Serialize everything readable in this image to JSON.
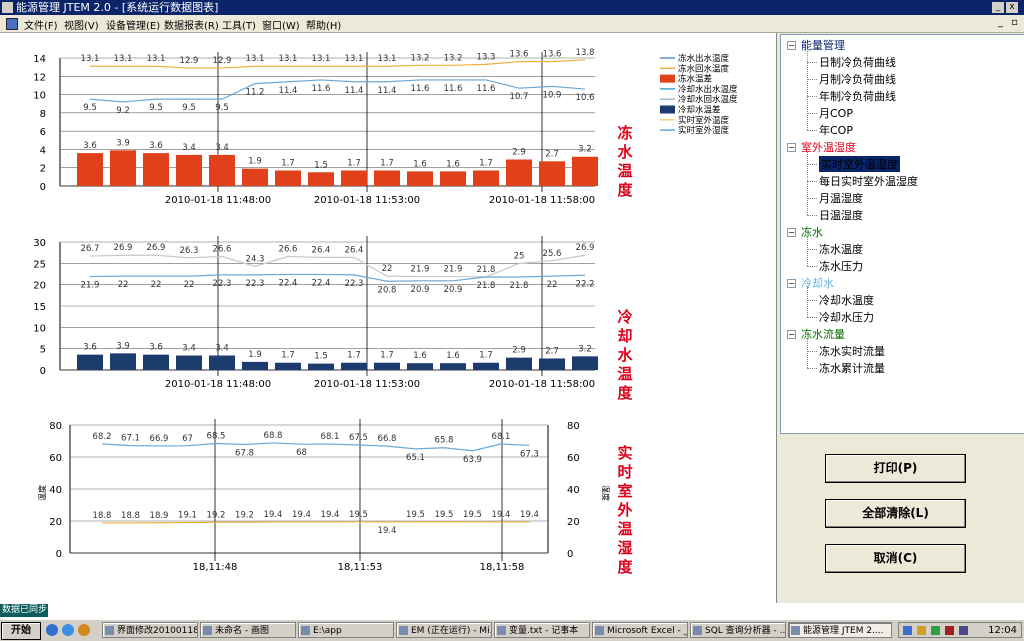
{
  "window": {
    "title": "能源管理  JTEM 2.0 - [系统运行数据图表]"
  },
  "menu": [
    "文件(F)",
    "视图(V)",
    "设备管理(E)",
    "数据报表(R)",
    "工具(T)",
    "窗口(W)",
    "帮助(H)"
  ],
  "chart_data": [
    {
      "type": "bar",
      "title": "冻水温度",
      "x": [
        "2010-01-18 11:48:00",
        "2010-01-18 11:53:00",
        "2010-01-18 11:58:00"
      ],
      "ylim": [
        0,
        14
      ],
      "yticks": [
        "0",
        "2",
        "4",
        "6",
        "8",
        "10",
        "12",
        "14"
      ],
      "legend": [
        "冻水出水温度",
        "冻水回水温度",
        "冻水温差",
        "冷却水出水温度",
        "冷却水回水温度",
        "冷却水温差",
        "实时室外温度",
        "实时室外湿度"
      ],
      "series": [
        {
          "name": "冻水温差",
          "values": [
            3.6,
            3.9,
            3.6,
            3.4,
            3.4,
            1.9,
            1.7,
            1.5,
            1.7,
            1.7,
            1.6,
            1.6,
            1.7,
            2.9,
            2.7,
            3.2
          ]
        },
        {
          "name": "冻水回水温度",
          "values": [
            13.1,
            13.1,
            13.1,
            12.9,
            12.9,
            13.1,
            13.1,
            13.1,
            13.1,
            13.1,
            13.2,
            13.2,
            13.3,
            13.6,
            13.6,
            13.8
          ]
        },
        {
          "name": "冻水出水温度",
          "values": [
            9.5,
            9.2,
            9.5,
            9.5,
            9.5,
            11.2,
            11.4,
            11.6,
            11.4,
            11.4,
            11.6,
            11.6,
            11.6,
            10.7,
            10.9,
            10.6
          ]
        }
      ]
    },
    {
      "type": "bar",
      "title": "冷却水温度",
      "x": [
        "2010-01-18 11:48:00",
        "2010-01-18 11:53:00",
        "2010-01-18 11:58:00"
      ],
      "ylim": [
        0,
        30
      ],
      "yticks": [
        "0",
        "5",
        "10",
        "15",
        "20",
        "25",
        "30"
      ],
      "series": [
        {
          "name": "冷却水温差",
          "values": [
            3.6,
            3.9,
            3.6,
            3.4,
            3.4,
            1.9,
            1.7,
            1.5,
            1.7,
            1.7,
            1.6,
            1.6,
            1.7,
            2.9,
            2.7,
            3.2
          ]
        },
        {
          "name": "冷却水出水温度",
          "values": [
            26.7,
            26.9,
            26.9,
            26.3,
            26.6,
            24.3,
            26.6,
            26.4,
            26.4,
            22,
            21.9,
            21.9,
            21.8,
            25,
            25.6,
            26.9
          ]
        },
        {
          "name": "冷却水回水温度",
          "values": [
            21.9,
            22,
            22,
            22,
            22.3,
            22.3,
            22.4,
            22.4,
            22.3,
            20.8,
            20.9,
            20.9,
            21.8,
            21.8,
            22,
            22.2
          ]
        }
      ]
    },
    {
      "type": "line",
      "title": "实时室外温湿度",
      "x": [
        "18,11:48",
        "18,11:53",
        "18,11:58"
      ],
      "ylim": [
        0,
        80
      ],
      "yticks": [
        "0",
        "20",
        "40",
        "60",
        "80"
      ],
      "ylabel_left": "温度",
      "ylabel_right": "湿度",
      "series": [
        {
          "name": "实时室外湿度",
          "values": [
            68.2,
            67.1,
            66.9,
            67,
            68.5,
            67.8,
            68.8,
            68,
            68.1,
            67.5,
            66.8,
            65.1,
            65.8,
            63.9,
            68.1,
            67.3
          ]
        },
        {
          "name": "实时室外温度",
          "values": [
            18.8,
            18.8,
            18.9,
            19.1,
            19.2,
            19.2,
            19.4,
            19.4,
            19.4,
            19.5,
            19.4,
            19.5,
            19.5,
            19.5,
            19.4,
            19.4
          ]
        }
      ]
    }
  ],
  "tree": {
    "groups": [
      {
        "label": "能量管理",
        "color": "#0a246a",
        "items": [
          "日制冷负荷曲线",
          "月制冷负荷曲线",
          "年制冷负荷曲线",
          "月COP",
          "年COP"
        ]
      },
      {
        "label": "室外温湿度",
        "color": "#e0001b",
        "items": [
          "实时室外温湿度",
          "每日实时室外温湿度",
          "月温湿度",
          "日温湿度"
        ]
      },
      {
        "label": "冻水",
        "color": "#007000",
        "items": [
          "冻水温度",
          "冻水压力"
        ]
      },
      {
        "label": "冷却水",
        "color": "#6ab0e0",
        "items": [
          "冷却水温度",
          "冷却水压力"
        ]
      },
      {
        "label": "冻水流量",
        "color": "#007000",
        "items": [
          "冻水实时流量",
          "冻水累计流量"
        ]
      }
    ],
    "selected": "实时室外温湿度"
  },
  "buttons": {
    "print": "打印(P)",
    "clear": "全部清除(L)",
    "cancel": "取消(C)"
  },
  "status": "数据已同步",
  "taskbar": {
    "start": "开始",
    "tasks": [
      "界面修改20100118...",
      "未命名 - 画图",
      "E:\\app",
      "EM (正在运行) - Mi...",
      "变量.txt - 记事本",
      "Microsoft Excel - _G...",
      "SQL 查询分析器 - ...",
      "能源管理  JTEM 2...."
    ],
    "clock": "12:04"
  },
  "colors": {
    "bar_red": "#e0401a",
    "bar_navy": "#1c3c6e",
    "line_blue": "#6aa8d8",
    "line_orange": "#f0b040",
    "red_title": "#e0001b"
  }
}
